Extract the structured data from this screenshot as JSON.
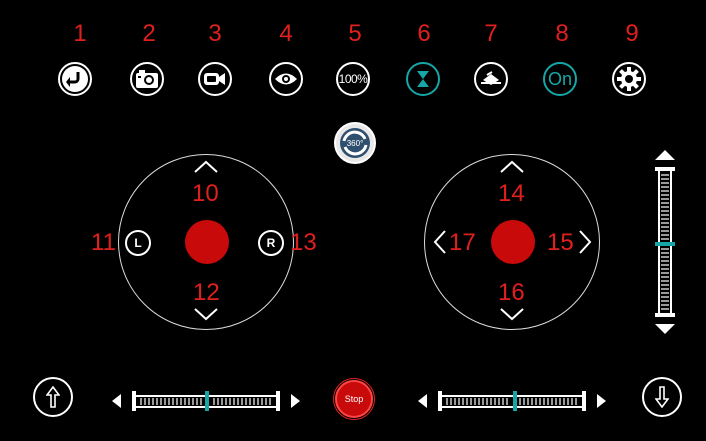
{
  "toolbar": {
    "numbers": [
      "1",
      "2",
      "3",
      "4",
      "5",
      "6",
      "7",
      "8",
      "9"
    ],
    "zoom_label": "100%",
    "on_label": "On",
    "accent": "#17a6a6",
    "icons": [
      "return-icon",
      "camera-icon",
      "video-icon",
      "eye-icon",
      "zoom-percent",
      "hourglass-icon",
      "align-icon",
      "toggle-on",
      "settings-gear-icon"
    ]
  },
  "rotate_button": {
    "label": "360°"
  },
  "left_joystick": {
    "up_num": "10",
    "left_num": "11",
    "down_num": "12",
    "right_num": "13",
    "left_letter": "L",
    "right_letter": "R"
  },
  "right_joystick": {
    "up_num": "14",
    "right_num": "15",
    "down_num": "16",
    "left_num": "17"
  },
  "bottom": {
    "stop_label": "Stop"
  },
  "colors": {
    "red": "#e0201e",
    "knob": "#c80a0a",
    "teal": "#17a6a6"
  }
}
